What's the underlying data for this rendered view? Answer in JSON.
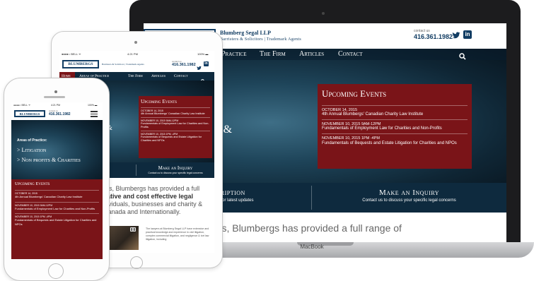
{
  "laptop": {
    "brand": "MacBook",
    "logo_title": "Blumberg Segal LLP",
    "logo_subtitle": "Barristers & Solicitors | Trademark Agents",
    "contact_label": "contact us",
    "phone": "416.361.1982",
    "nav": [
      "Practice",
      "The Firm",
      "Articles",
      "Contact"
    ],
    "hero_partial_1": "n",
    "hero_partial_2": "ts &",
    "events_title": "Upcoming Events",
    "events": [
      {
        "date": "OCTOBER 14, 2015",
        "title": "4th Annual Blumbergs' Canadian Charity Law Institute"
      },
      {
        "date": "NOVEMBER 10, 2015 9AM-12PM",
        "title": "Fundamentals of Employment Law for Charities and Non-Profits"
      },
      {
        "date": "NOVEMBER 10, 2015 1PM -4PM",
        "title": "Fundamentals of Bequests and Estate Litigation for Charities and NPOs"
      }
    ],
    "subscription_title": "bscription",
    "subscription_sub": "newsletter for latest updates",
    "inquiry_title": "Make an Inquiry",
    "inquiry_sub": "Contact us to discuss your specific legal concerns",
    "body_text": "ars, Blumbergs has provided a full range of"
  },
  "tablet": {
    "status_left": "●●●●○ BELL ᯤ",
    "status_time": "4:21 PM",
    "status_right": "100% ▬",
    "logo": "BLUMBERGS",
    "logo_subtitle": "Barristers & Solicitors | Trademark Agents",
    "contact_label": "contact us",
    "phone": "416.361.1982",
    "nav": [
      "Home",
      "Areas of Practice",
      "The Firm",
      "Articles",
      "Contact"
    ],
    "events_title": "Upcoming Events",
    "events": [
      {
        "date": "OCTOBER 14, 2015",
        "title": "4th Annual Blumbergs' Canadian Charity Law Institute"
      },
      {
        "date": "NOVEMBER 10, 2015 9AM-12PM",
        "title": "Fundamentals of Employment Law for Charities and Non-Profits"
      },
      {
        "date": "NOVEMBER 10, 2015 1PM -4PM",
        "title": "Fundamentals of Bequests and Estate Litigation for Charities and NPOs"
      }
    ],
    "hero_partial_1": "n",
    "hero_partial_2": "ts &",
    "subscription_title": "scription",
    "subscription_sub": "for latest updates",
    "inquiry_title": "Make an Inquiry",
    "inquiry_sub": "Contact us to discuss your specific legal concerns",
    "body_line_1": "ars, Blumbergs has provided a full",
    "body_line_2": "vative and cost effective legal",
    "body_line_3": "dividuals, businesses and charity &",
    "body_line_4": "Canada and Internationally.",
    "blurb": "The lawyers at Blumberg Segal LLP have extensive and practical knowledge and experience in civil litigation, complex commercial litigation, and negligence & tort law litigation, including"
  },
  "phone": {
    "status_left": "●●●●○ BELL ᯤ",
    "status_time": "4:21 PM",
    "status_right": "100% ▬",
    "logo": "BLUMBERGS",
    "contact_label": "contact us",
    "phone": "416.361.1982",
    "areas_label": "Areas of Practice:",
    "areas": [
      "Litigation",
      "Non profits & Charities"
    ],
    "events_title": "Upcoming Events",
    "events": [
      {
        "date": "OCTOBER 14, 2015",
        "title": "4th Annual Blumbergs' Canadian Charity Law Institute"
      },
      {
        "date": "NOVEMBER 10, 2015 9AM-12PM",
        "title": "Fundamentals of Employment Law for Charities and Non-Profits"
      },
      {
        "date": "NOVEMBER 10, 2015 1PM -4PM",
        "title": "Fundamentals of Bequests and Estate Litigation for Charities and NPOs"
      }
    ]
  },
  "colors": {
    "navy": "#0e2a3e",
    "brand_blue": "#123d63",
    "event_red": "#7a1418"
  }
}
